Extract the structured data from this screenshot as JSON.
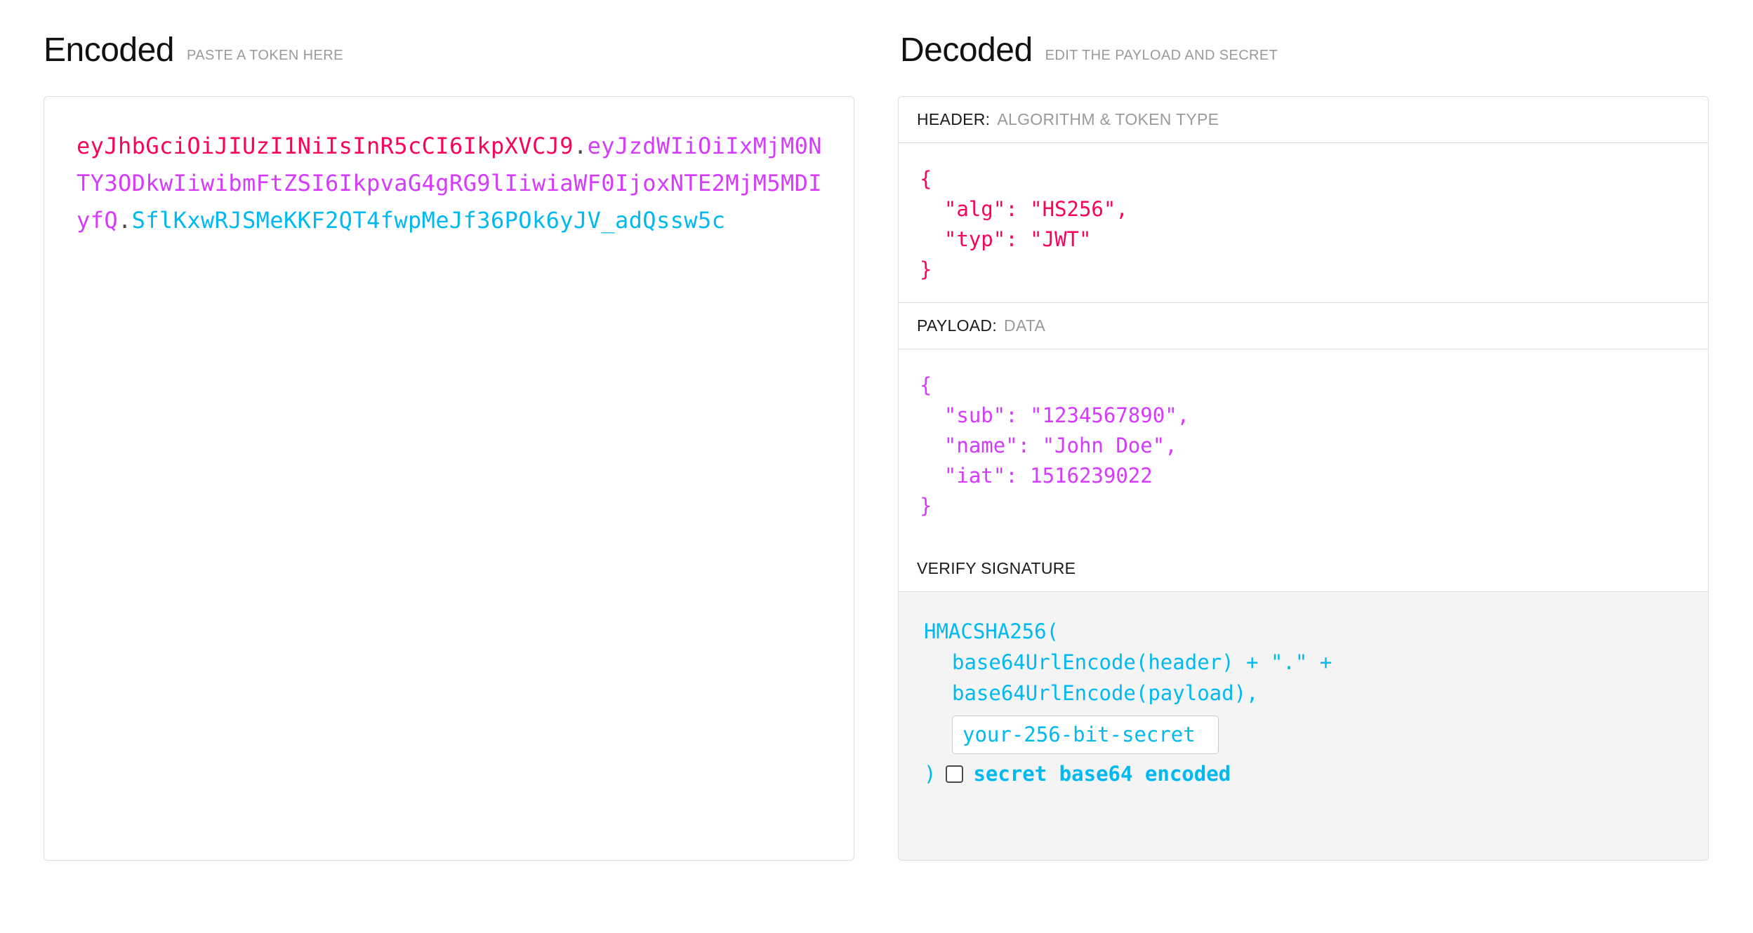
{
  "colors": {
    "header_pink": "#fb015b",
    "payload_magenta": "#d63aff",
    "signature_cyan": "#00b9f1",
    "panel_border": "#dddddd",
    "verify_background": "#f4f4f4",
    "subtitle_gray": "#9a9a9a"
  },
  "encoded": {
    "title": "Encoded",
    "subtitle": "PASTE A TOKEN HERE",
    "token": {
      "header": "eyJhbGciOiJIUzI1NiIsInR5cCI6IkpXVCJ9",
      "dot1": ".",
      "payload": "eyJzdWIiOiIxMjM0NTY3ODkwIiwibmFtZSI6IkpvaG4gRG9lIiwiaWF0IjoxNTE2MjM5MDIyfQ",
      "dot2": ".",
      "signature": "SflKxwRJSMeKKF2QT4fwpMeJf36POk6yJV_adQssw5c"
    }
  },
  "decoded": {
    "title": "Decoded",
    "subtitle": "EDIT THE PAYLOAD AND SECRET",
    "header_section": {
      "label": "HEADER:",
      "sublabel": "ALGORITHM & TOKEN TYPE",
      "json": "{\n  \"alg\": \"HS256\",\n  \"typ\": \"JWT\"\n}"
    },
    "payload_section": {
      "label": "PAYLOAD:",
      "sublabel": "DATA",
      "json": "{\n  \"sub\": \"1234567890\",\n  \"name\": \"John Doe\",\n  \"iat\": 1516239022\n}"
    },
    "verify_section": {
      "label": "VERIFY SIGNATURE",
      "line1": "HMACSHA256(",
      "line2": "base64UrlEncode(header) + \".\" +",
      "line3": "base64UrlEncode(payload),",
      "secret_value": "your-256-bit-secret",
      "secret_placeholder": "your-256-bit-secret",
      "closing_paren": ")",
      "base64_label": "secret base64 encoded",
      "base64_checked": false
    }
  }
}
